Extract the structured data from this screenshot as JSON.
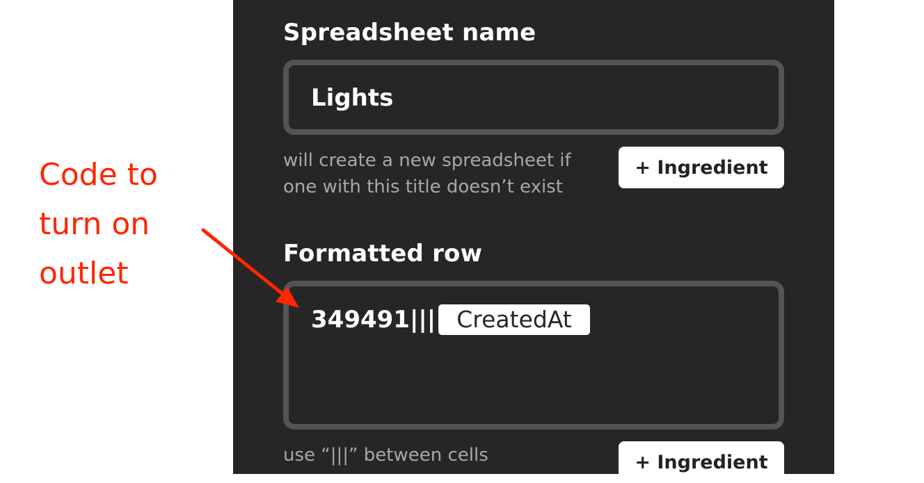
{
  "panel": {
    "sections": [
      {
        "label": "Spreadsheet name",
        "value": "Lights",
        "helper_lines": [
          "will create a new spreadsheet if",
          "one with this title doesn’t exist"
        ],
        "button_label": "+ Ingredient"
      },
      {
        "label": "Formatted row",
        "value_text": "349491|||",
        "pill_label": "CreatedAt",
        "helper_lines": [
          "use “|||” between cells"
        ],
        "button_label": "+ Ingredient"
      }
    ]
  },
  "annotation": {
    "lines": [
      "Code to",
      "turn on",
      "outlet"
    ],
    "color": "#ff2600"
  },
  "colors": {
    "panel_bg": "#262626",
    "input_border": "#545454",
    "helper_text": "#a8a8a8",
    "button_bg": "#ffffff"
  }
}
